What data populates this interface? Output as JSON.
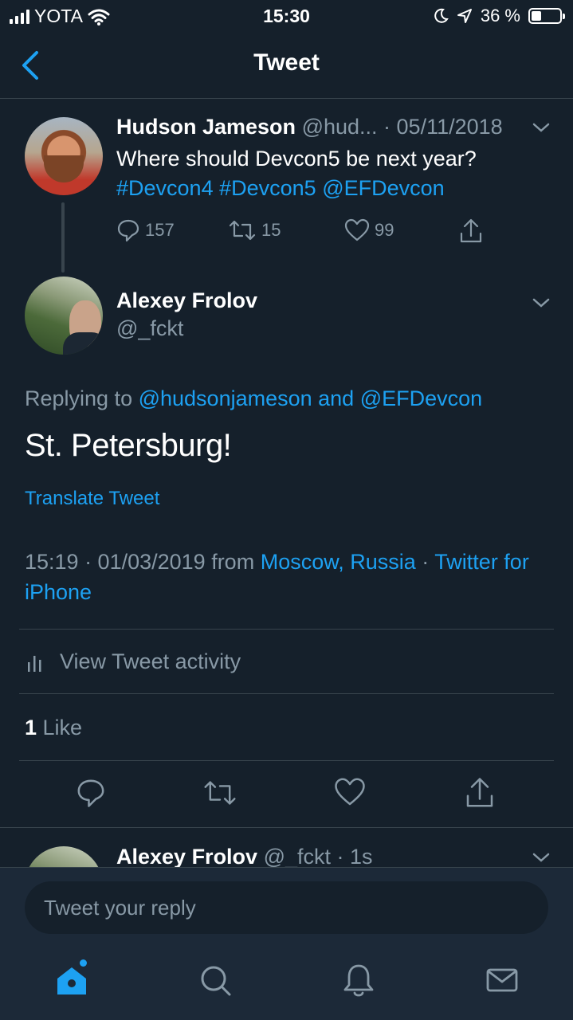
{
  "status_bar": {
    "carrier": "YOTA",
    "time": "15:30",
    "battery_percent": "36 %",
    "battery_level": 0.36
  },
  "header": {
    "title": "Tweet",
    "back_icon": "chevron-left-icon"
  },
  "parent_tweet": {
    "name": "Hudson Jameson",
    "handle": "@hud...",
    "sep": " · ",
    "date": "05/11/2018",
    "text": "Where should Devcon5 be next year?",
    "tags": [
      "#Devcon4",
      "#Devcon5",
      "@EFDevcon"
    ],
    "replies": "157",
    "retweets": "15",
    "likes": "99"
  },
  "main_tweet": {
    "name": "Alexey Frolov",
    "handle": "@_fckt",
    "replying_prefix": "Replying to ",
    "replying_user1": "@hudsonjameson",
    "replying_and": " and ",
    "replying_user2": "@EFDevcon",
    "text": "St. Petersburg!",
    "translate": "Translate Tweet",
    "time": "15:19 · 01/03/2019 from ",
    "location": "Moscow, Russia",
    "sep": " · ",
    "client": "Twitter for iPhone",
    "activity": "View Tweet activity",
    "like_count": "1",
    "like_label": " Like"
  },
  "reply_preview": {
    "name": "Alexey Frolov",
    "handle": " @_fckt",
    "time": " · 1s"
  },
  "reply_bar": {
    "placeholder": "Tweet your reply"
  },
  "tabbar": {
    "items": [
      "home-icon",
      "search-icon",
      "notifications-icon",
      "messages-icon"
    ]
  },
  "colors": {
    "background": "#15202b",
    "accent": "#1da1f2",
    "secondary_text": "#8899a6",
    "divider": "#38444d"
  }
}
